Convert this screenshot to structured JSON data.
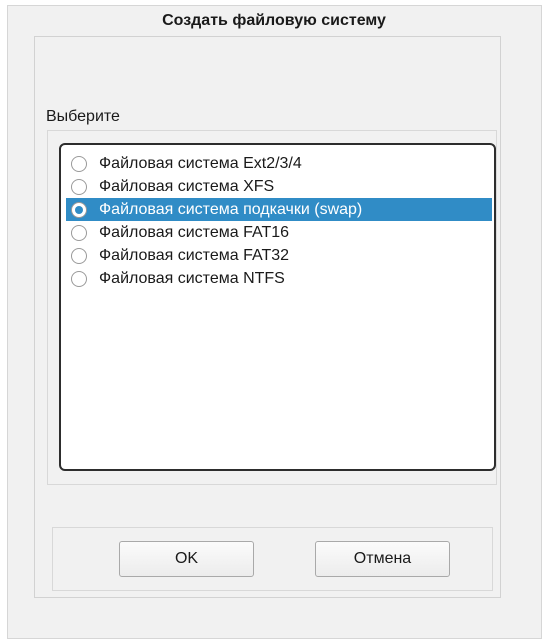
{
  "dialog": {
    "title": "Создать файловую систему",
    "choose_label": "Выберите",
    "options": [
      {
        "label": "Файловая система Ext2/3/4",
        "selected": false
      },
      {
        "label": "Файловая система XFS",
        "selected": false
      },
      {
        "label": "Файловая система подкачки (swap)",
        "selected": true
      },
      {
        "label": "Файловая система FAT16",
        "selected": false
      },
      {
        "label": "Файловая система FAT32",
        "selected": false
      },
      {
        "label": "Файловая система NTFS",
        "selected": false
      }
    ],
    "ok_label": "OK",
    "cancel_label": "Отмена"
  },
  "colors": {
    "selection": "#308cc6",
    "window_bg": "#f1f1f1"
  }
}
